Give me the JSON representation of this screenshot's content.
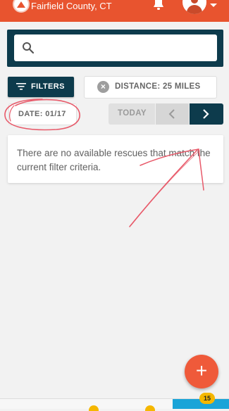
{
  "header": {
    "title": "Fairfield County, CT"
  },
  "search": {
    "placeholder": "",
    "value": ""
  },
  "filters": {
    "filters_label": "FILTERS",
    "distance_label": "DISTANCE: 25 MILES",
    "date_label": "DATE: 01/17",
    "today_label": "TODAY"
  },
  "results": {
    "empty_message": "There are no available rescues that match the current filter criteria."
  },
  "fab": {
    "label": "+"
  },
  "bottom_nav": {
    "badge_count": "15"
  },
  "colors": {
    "header": "#e8542f",
    "primary": "#0d3b4c",
    "fab": "#ef5a3a",
    "badge": "#f5b700",
    "nav_active": "#1aa4d8",
    "annotation": "#e85a6a"
  }
}
